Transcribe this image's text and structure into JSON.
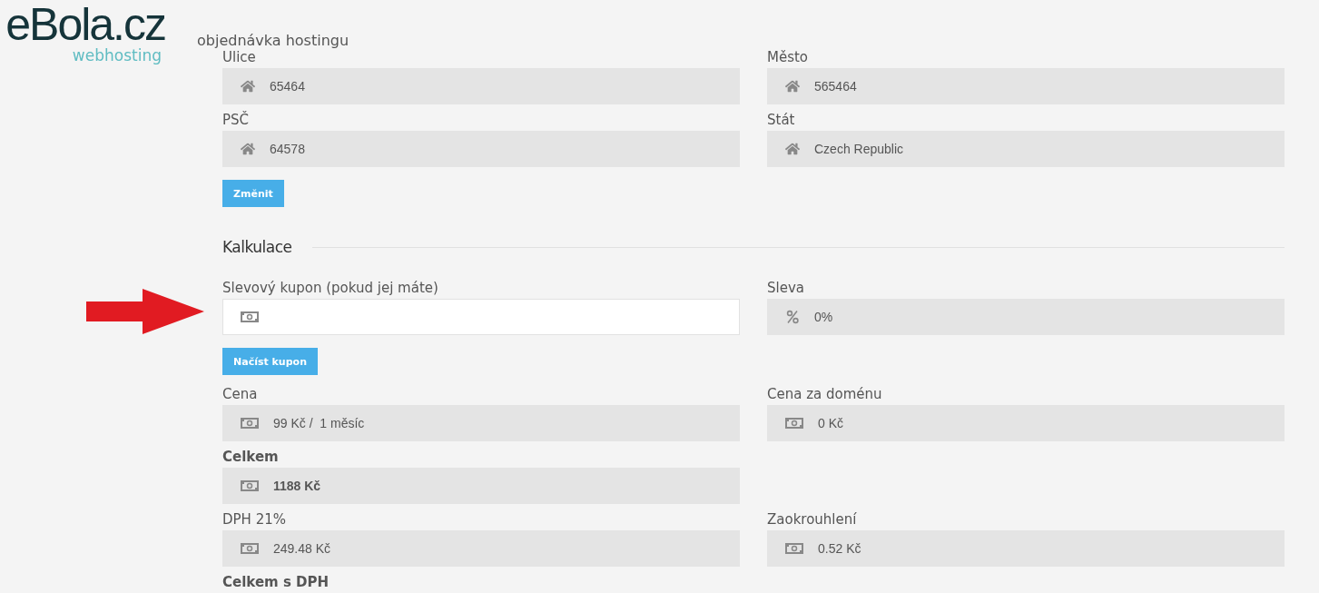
{
  "logo": {
    "name": "eBola.cz",
    "tagline": "webhosting"
  },
  "page_title": "objednávka hostingu",
  "blocks": [
    {
      "kind": "fields",
      "fields": [
        {
          "label": "Ulice",
          "kind": "address",
          "value": "65464",
          "editable": false,
          "strong": false
        },
        {
          "label": "Město",
          "kind": "address",
          "value": "565464",
          "editable": false,
          "strong": false
        }
      ]
    },
    {
      "kind": "fields",
      "fields": [
        {
          "label": "PSČ",
          "kind": "address",
          "value": "64578",
          "editable": false,
          "strong": false
        },
        {
          "label": "Stát",
          "kind": "address",
          "value": "Czech Republic",
          "editable": false,
          "strong": false
        }
      ]
    },
    {
      "kind": "button",
      "label": "Změnit"
    },
    {
      "kind": "heading",
      "label": "Kalkulace"
    },
    {
      "kind": "fields",
      "fields": [
        {
          "label": "Slevový kupon (pokud jej máte)",
          "kind": "money",
          "editable": true,
          "strong": false,
          "pointed": true
        },
        {
          "label": "Sleva",
          "kind": "percent",
          "value": "0%",
          "editable": false,
          "strong": false
        }
      ]
    },
    {
      "kind": "button",
      "label": "Načíst kupon"
    },
    {
      "kind": "fields",
      "fields": [
        {
          "label": "Cena",
          "kind": "money",
          "value": "99 Kč /  1 měsíc",
          "editable": false,
          "strong": false
        },
        {
          "label": "Cena za doménu",
          "kind": "money",
          "value": "0 Kč",
          "editable": false,
          "strong": false
        }
      ]
    },
    {
      "kind": "fields",
      "fields": [
        {
          "label": "Celkem",
          "kind": "money",
          "value": "1188 Kč",
          "editable": false,
          "strong": true
        }
      ]
    },
    {
      "kind": "fields",
      "fields": [
        {
          "label": "DPH 21%",
          "kind": "money",
          "value": "249.48 Kč",
          "editable": false,
          "strong": false
        },
        {
          "label": "Zaokrouhlení",
          "kind": "money",
          "value": "0.52 Kč",
          "editable": false,
          "strong": false
        }
      ]
    },
    {
      "kind": "label",
      "label": "Celkem s DPH"
    }
  ]
}
